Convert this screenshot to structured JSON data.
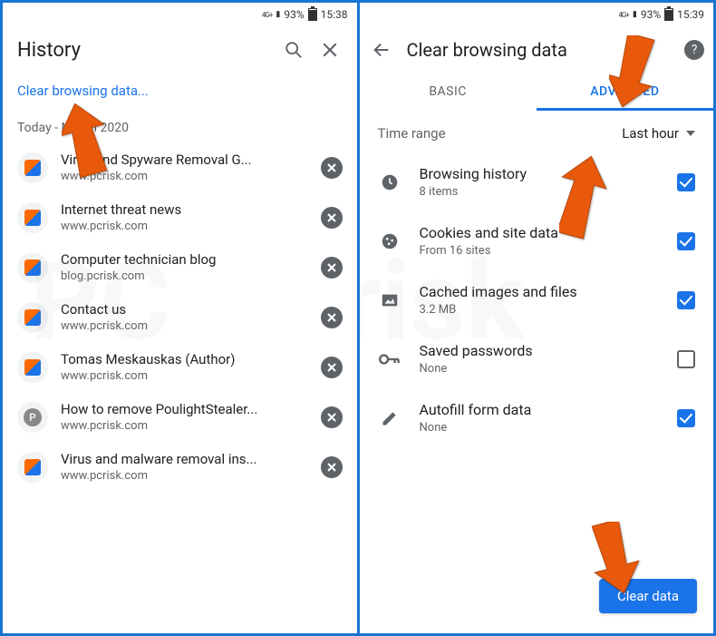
{
  "left": {
    "statusbar": {
      "net": "4G+",
      "battery_pct": "93%",
      "time": "15:38"
    },
    "title": "History",
    "clear_link": "Clear browsing data...",
    "date_label": "Today - March 2020",
    "items": [
      {
        "title": "Virus and Spyware Removal G...",
        "domain": "www.pcrisk.com",
        "icon": "pcrisk"
      },
      {
        "title": "Internet threat news",
        "domain": "www.pcrisk.com",
        "icon": "pcrisk"
      },
      {
        "title": "Computer technician blog",
        "domain": "blog.pcrisk.com",
        "icon": "pcrisk"
      },
      {
        "title": "Contact us",
        "domain": "www.pcrisk.com",
        "icon": "pcrisk"
      },
      {
        "title": "Tomas Meskauskas (Author)",
        "domain": "www.pcrisk.com",
        "icon": "pcrisk"
      },
      {
        "title": "How to remove PoulightStealer...",
        "domain": "www.pcrisk.com",
        "icon": "gray-p"
      },
      {
        "title": "Virus and malware removal ins...",
        "domain": "www.pcrisk.com",
        "icon": "pcrisk"
      }
    ]
  },
  "right": {
    "statusbar": {
      "net": "4G+",
      "battery_pct": "93%",
      "time": "15:39"
    },
    "title": "Clear browsing data",
    "tabs": {
      "basic": "BASIC",
      "advanced": "ADVANCED"
    },
    "time_range": {
      "label": "Time range",
      "value": "Last hour"
    },
    "items": [
      {
        "icon": "clock",
        "name": "Browsing history",
        "sub": "8 items",
        "checked": true
      },
      {
        "icon": "cookie",
        "name": "Cookies and site data",
        "sub": "From 16 sites",
        "checked": true
      },
      {
        "icon": "image",
        "name": "Cached images and files",
        "sub": "3.2 MB",
        "checked": true
      },
      {
        "icon": "key",
        "name": "Saved passwords",
        "sub": "None",
        "checked": false
      },
      {
        "icon": "pencil",
        "name": "Autofill form data",
        "sub": "None",
        "checked": true
      }
    ],
    "button": "Clear data"
  }
}
